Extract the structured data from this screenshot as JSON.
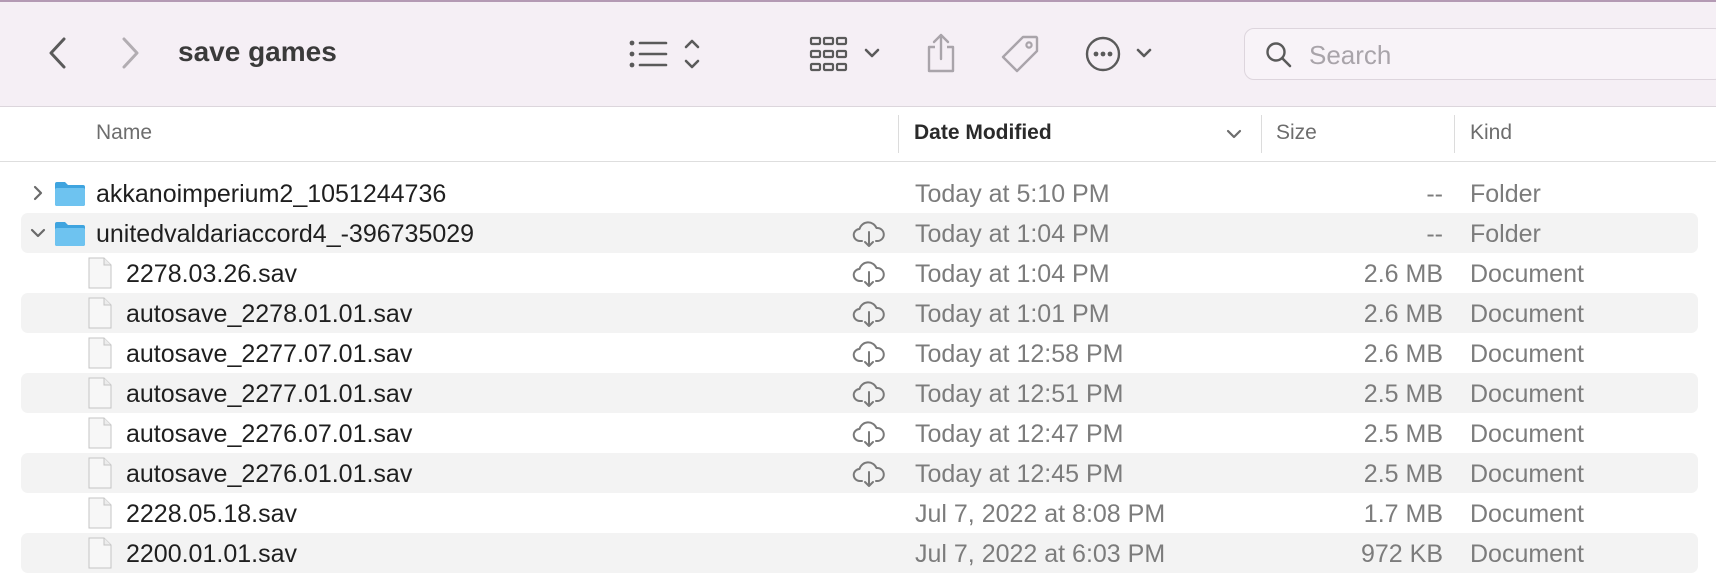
{
  "window": {
    "title": "save games"
  },
  "toolbar": {
    "back_icon": "chevron-left-icon",
    "forward_icon": "chevron-right-icon",
    "view_icon": "list-view-icon",
    "group_icon": "grid-group-icon",
    "share_icon": "share-icon",
    "tag_icon": "tag-icon",
    "more_icon": "ellipsis-circle-icon"
  },
  "search": {
    "placeholder": "Search",
    "value": ""
  },
  "columns": {
    "name": "Name",
    "date": "Date Modified",
    "size": "Size",
    "kind": "Kind",
    "sorted_by": "Date Modified",
    "sort_direction": "descending"
  },
  "rows": [
    {
      "name": "akkanoimperium2_1051244736",
      "date": "Today at 5:10 PM",
      "size": "--",
      "kind": "Folder",
      "type": "folder",
      "expanded": false,
      "icloud": false
    },
    {
      "name": "unitedvaldariaccord4_-396735029",
      "date": "Today at 1:04 PM",
      "size": "--",
      "kind": "Folder",
      "type": "folder",
      "expanded": true,
      "icloud": true
    },
    {
      "name": "2278.03.26.sav",
      "date": "Today at 1:04 PM",
      "size": "2.6 MB",
      "kind": "Document",
      "type": "file",
      "icloud": true
    },
    {
      "name": "autosave_2278.01.01.sav",
      "date": "Today at 1:01 PM",
      "size": "2.6 MB",
      "kind": "Document",
      "type": "file",
      "icloud": true
    },
    {
      "name": "autosave_2277.07.01.sav",
      "date": "Today at 12:58 PM",
      "size": "2.6 MB",
      "kind": "Document",
      "type": "file",
      "icloud": true
    },
    {
      "name": "autosave_2277.01.01.sav",
      "date": "Today at 12:51 PM",
      "size": "2.5 MB",
      "kind": "Document",
      "type": "file",
      "icloud": true
    },
    {
      "name": "autosave_2276.07.01.sav",
      "date": "Today at 12:47 PM",
      "size": "2.5 MB",
      "kind": "Document",
      "type": "file",
      "icloud": true
    },
    {
      "name": "autosave_2276.01.01.sav",
      "date": "Today at 12:45 PM",
      "size": "2.5 MB",
      "kind": "Document",
      "type": "file",
      "icloud": true
    },
    {
      "name": "2228.05.18.sav",
      "date": "Jul 7, 2022 at 8:08 PM",
      "size": "1.7 MB",
      "kind": "Document",
      "type": "file",
      "icloud": false
    },
    {
      "name": "2200.01.01.sav",
      "date": "Jul 7, 2022 at 6:03 PM",
      "size": "972 KB",
      "kind": "Document",
      "type": "file",
      "icloud": false
    }
  ],
  "colors": {
    "toolbar_bg": "#f5eff5",
    "row_alt_bg": "#f3f3f3",
    "folder_blue": "#5cb8ec",
    "secondary_text": "#7c7c7c"
  }
}
